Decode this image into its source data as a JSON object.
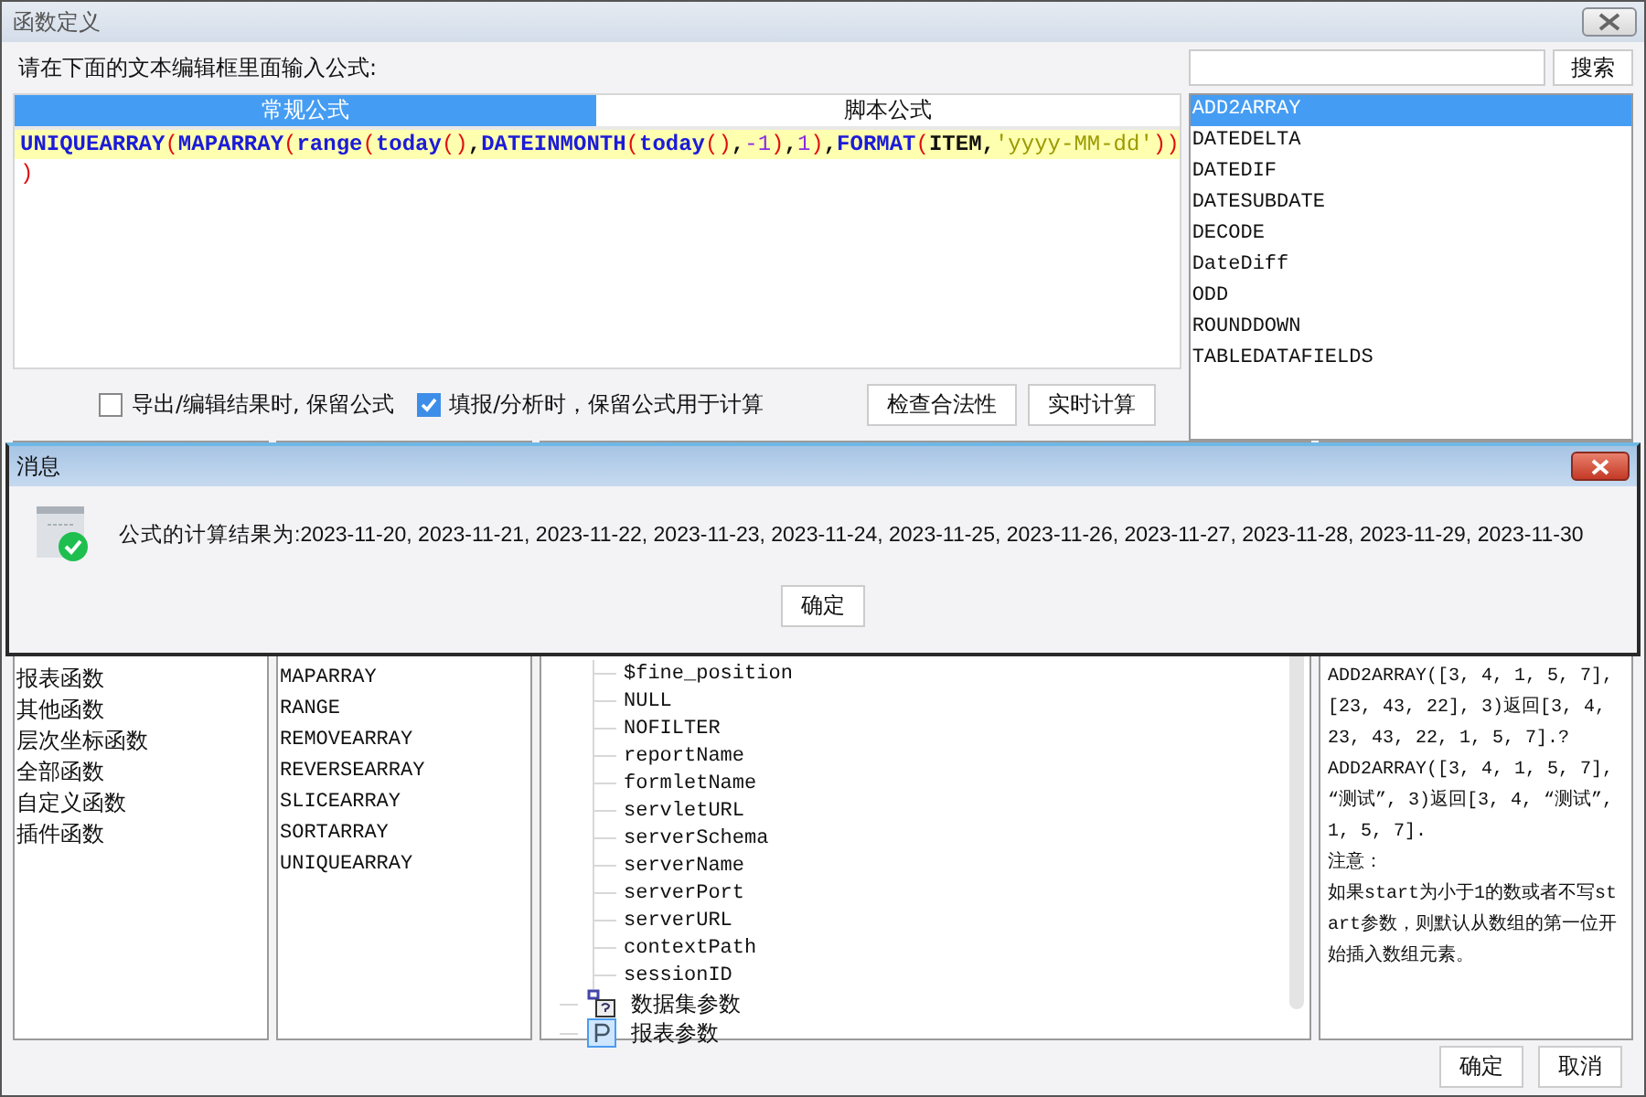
{
  "window": {
    "title": "函数定义"
  },
  "editor": {
    "prompt": "请在下面的文本编辑框里面输入公式:",
    "tabs": [
      {
        "label": "常规公式",
        "selected": true
      },
      {
        "label": "脚本公式",
        "selected": false
      }
    ],
    "lines": [
      {
        "current": true,
        "tokens": [
          {
            "kind": "func",
            "text": "UNIQUEARRAY"
          },
          {
            "kind": "paren",
            "text": "("
          },
          {
            "kind": "func",
            "text": "MAPARRAY"
          },
          {
            "kind": "paren",
            "text": "("
          },
          {
            "kind": "func",
            "text": "range"
          },
          {
            "kind": "paren",
            "text": "("
          },
          {
            "kind": "func",
            "text": "today"
          },
          {
            "kind": "paren",
            "text": "()"
          },
          {
            "kind": "plain",
            "text": ","
          },
          {
            "kind": "func",
            "text": "DATEINMONTH"
          },
          {
            "kind": "paren",
            "text": "("
          },
          {
            "kind": "func",
            "text": "today"
          },
          {
            "kind": "paren",
            "text": "()"
          },
          {
            "kind": "plain",
            "text": ","
          },
          {
            "kind": "number",
            "text": "-1"
          },
          {
            "kind": "paren",
            "text": ")"
          },
          {
            "kind": "plain",
            "text": ","
          },
          {
            "kind": "number",
            "text": "1"
          },
          {
            "kind": "paren",
            "text": ")"
          },
          {
            "kind": "plain",
            "text": ","
          },
          {
            "kind": "func",
            "text": "FORMAT"
          },
          {
            "kind": "paren",
            "text": "("
          },
          {
            "kind": "plain",
            "text": "ITEM,"
          },
          {
            "kind": "string",
            "text": "'yyyy-MM-dd'"
          },
          {
            "kind": "paren",
            "text": "))"
          }
        ]
      },
      {
        "current": false,
        "tokens": [
          {
            "kind": "paren",
            "text": ")"
          }
        ]
      }
    ]
  },
  "options": [
    {
      "label": "导出/编辑结果时, 保留公式",
      "checked": false
    },
    {
      "label": "填报/分析时，保留公式用于计算",
      "checked": true
    }
  ],
  "actions": [
    "检查合法性",
    "实时计算"
  ],
  "search": {
    "button": "搜索"
  },
  "function_list": [
    {
      "label": "ADD2ARRAY",
      "selected": true
    },
    {
      "label": "DATEDELTA",
      "selected": false
    },
    {
      "label": "DATEDIF",
      "selected": false
    },
    {
      "label": "DATESUBDATE",
      "selected": false
    },
    {
      "label": "DECODE",
      "selected": false
    },
    {
      "label": "DateDiff",
      "selected": false
    },
    {
      "label": "ODD",
      "selected": false
    },
    {
      "label": "ROUNDDOWN",
      "selected": false
    },
    {
      "label": "TABLEDATAFIELDS",
      "selected": false
    }
  ],
  "categories": [
    {
      "label": "报表函数",
      "selected": false
    },
    {
      "label": "其他函数",
      "selected": false
    },
    {
      "label": "层次坐标函数",
      "selected": false
    },
    {
      "label": "全部函数",
      "selected": false
    },
    {
      "label": "自定义函数",
      "selected": false
    },
    {
      "label": "插件函数",
      "selected": false
    }
  ],
  "functions": [
    {
      "label": "MAPARRAY",
      "selected": false
    },
    {
      "label": "RANGE",
      "selected": false
    },
    {
      "label": "REMOVEARRAY",
      "selected": false
    },
    {
      "label": "REVERSEARRAY",
      "selected": false
    },
    {
      "label": "SLICEARRAY",
      "selected": false
    },
    {
      "label": "SORTARRAY",
      "selected": false
    },
    {
      "label": "UNIQUEARRAY",
      "selected": false
    }
  ],
  "tree": {
    "nodes": [
      {
        "children": [
          {
            "label": "$fine_position"
          },
          {
            "label": "NULL"
          },
          {
            "label": "NOFILTER"
          },
          {
            "label": "reportName"
          },
          {
            "label": "formletName"
          },
          {
            "label": "servletURL"
          },
          {
            "label": "serverSchema"
          },
          {
            "label": "serverName"
          },
          {
            "label": "serverPort"
          },
          {
            "label": "serverURL"
          },
          {
            "label": "contextPath"
          },
          {
            "label": "sessionID"
          }
        ]
      },
      {
        "label": "数据集参数",
        "kind": "dataset"
      },
      {
        "label": "报表参数",
        "kind": "report_param"
      }
    ]
  },
  "description": [
    "ADD2ARRAY([3, 4, 1, 5, 7], [23, 43, 22], 3)返回[3, 4, 23, 43, 22, 1, 5, 7].?",
    "ADD2ARRAY([3, 4, 1, 5, 7], “测试”, 3)返回[3, 4, “测试”, 1, 5, 7].",
    "注意：",
    "如果start为小于1的数或者不写start参数，则默认从数组的第一位开始插入数组元素。"
  ],
  "buttons": [
    "确定",
    "取消"
  ],
  "message": {
    "title": "消息",
    "text": "公式的计算结果为:2023-11-20, 2023-11-21, 2023-11-22, 2023-11-23, 2023-11-24, 2023-11-25, 2023-11-26, 2023-11-27, 2023-11-28, 2023-11-29, 2023-11-30",
    "button": "确定"
  }
}
